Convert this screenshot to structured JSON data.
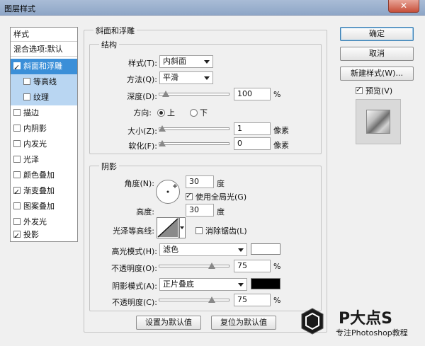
{
  "window": {
    "title": "图层样式",
    "close": "✕"
  },
  "sidebar": {
    "styles_header": "样式",
    "blend_default": "混合选项:默认",
    "items": [
      {
        "label": "斜面和浮雕",
        "checked": true
      },
      {
        "label": "等高线",
        "checked": false
      },
      {
        "label": "纹理",
        "checked": false
      },
      {
        "label": "描边",
        "checked": false
      },
      {
        "label": "内阴影",
        "checked": false
      },
      {
        "label": "内发光",
        "checked": false
      },
      {
        "label": "光泽",
        "checked": false
      },
      {
        "label": "颜色叠加",
        "checked": false
      },
      {
        "label": "渐变叠加",
        "checked": true
      },
      {
        "label": "图案叠加",
        "checked": false
      },
      {
        "label": "外发光",
        "checked": false
      },
      {
        "label": "投影",
        "checked": true
      }
    ]
  },
  "bevel": {
    "title": "斜面和浮雕",
    "structure_title": "结构",
    "style_label": "样式(T):",
    "style_value": "内斜面",
    "technique_label": "方法(Q):",
    "technique_value": "平滑",
    "depth_label": "深度(D):",
    "depth_value": "100",
    "depth_unit": "%",
    "direction_label": "方向:",
    "dir_up": "上",
    "dir_down": "下",
    "size_label": "大小(Z):",
    "size_value": "1",
    "size_unit": "像素",
    "soften_label": "软化(F):",
    "soften_value": "0",
    "soften_unit": "像素",
    "shading_title": "阴影",
    "angle_label": "角度(N):",
    "angle_value": "30",
    "angle_unit": "度",
    "global_light": "使用全局光(G)",
    "altitude_label": "高度:",
    "altitude_value": "30",
    "altitude_unit": "度",
    "gloss_label": "光泽等高线:",
    "antialias": "消除锯齿(L)",
    "highlight_label": "高光模式(H):",
    "highlight_value": "滤色",
    "highlight_color": "#ffffff",
    "opacity1_label": "不透明度(O):",
    "opacity1_value": "75",
    "opacity1_unit": "%",
    "shadow_label": "阴影模式(A):",
    "shadow_value": "正片叠底",
    "shadow_color": "#000000",
    "opacity2_label": "不透明度(C):",
    "opacity2_value": "75",
    "opacity2_unit": "%",
    "make_default": "设置为默认值",
    "reset_default": "复位为默认值"
  },
  "buttons": {
    "ok": "确定",
    "cancel": "取消",
    "new_style": "新建样式(W)...",
    "preview": "预览(V)"
  },
  "watermark": {
    "brand": "P大点S",
    "tagline": "专注Photoshop教程"
  }
}
